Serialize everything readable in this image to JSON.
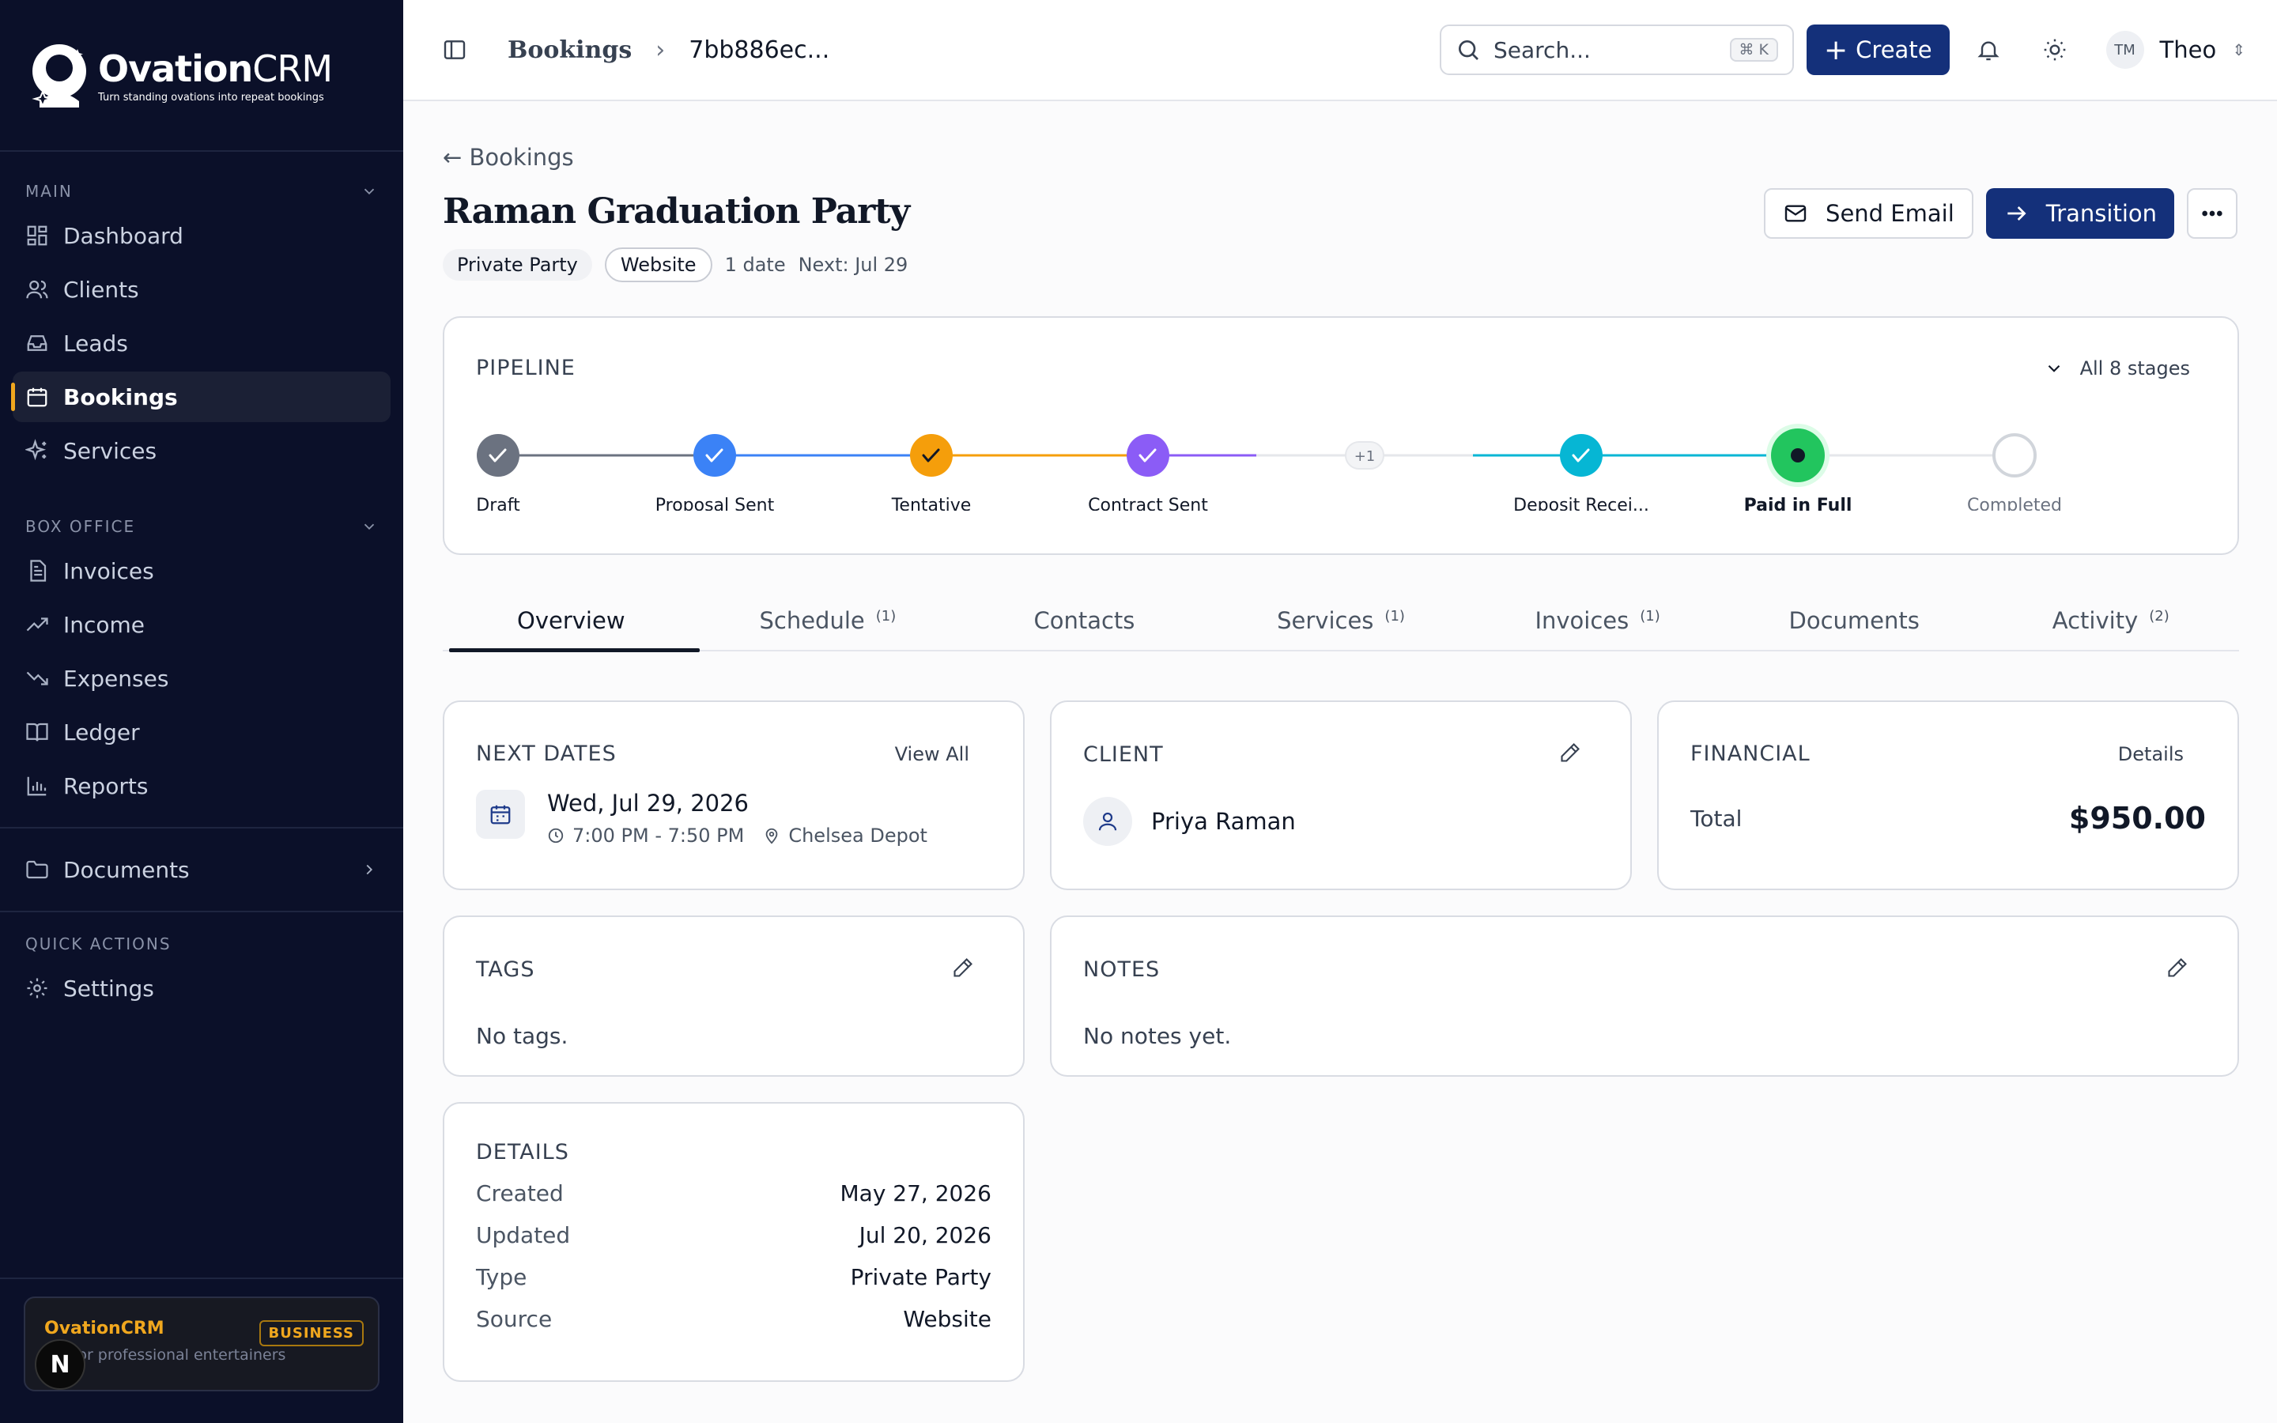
{
  "brand": {
    "name_bold": "Ovation",
    "name_light": "CRM",
    "tagline": "Turn standing ovations into repeat bookings"
  },
  "sidebar": {
    "sections": [
      {
        "title": "MAIN",
        "items": [
          {
            "label": "Dashboard",
            "icon": "dashboard-icon"
          },
          {
            "label": "Clients",
            "icon": "users-icon"
          },
          {
            "label": "Leads",
            "icon": "inbox-icon"
          },
          {
            "label": "Bookings",
            "icon": "calendar-icon",
            "active": true
          },
          {
            "label": "Services",
            "icon": "sparkles-icon"
          }
        ]
      },
      {
        "title": "BOX OFFICE",
        "items": [
          {
            "label": "Invoices",
            "icon": "file-icon"
          },
          {
            "label": "Income",
            "icon": "trend-up-icon"
          },
          {
            "label": "Expenses",
            "icon": "trend-down-icon"
          },
          {
            "label": "Ledger",
            "icon": "book-icon"
          },
          {
            "label": "Reports",
            "icon": "bar-chart-icon"
          }
        ]
      }
    ],
    "documents_label": "Documents",
    "quick_actions_title": "QUICK ACTIONS",
    "settings_label": "Settings",
    "plan": {
      "name": "OvationCRM",
      "desc": "RM for professional entertainers",
      "badge": "BUSINESS",
      "n_badge": "N"
    }
  },
  "topbar": {
    "breadcrumb_root": "Bookings",
    "breadcrumb_current": "7bb886ec...",
    "search_placeholder": "Search...",
    "search_shortcut": "⌘ K",
    "create_label": "Create",
    "user_initials": "TM",
    "user_name": "Theo"
  },
  "page": {
    "back_label": "← Bookings",
    "title": "Raman Graduation Party",
    "type_pill": "Private Party",
    "source_pill": "Website",
    "date_count": "1 date",
    "next_label": "Next: Jul 29",
    "send_email_label": "Send Email",
    "transition_label": "Transition"
  },
  "pipeline": {
    "title": "PIPELINE",
    "all_stages_label": "All 8 stages",
    "hidden_count": "+1",
    "stages": [
      {
        "label": "Draft",
        "status": "done",
        "color": "#6b7280"
      },
      {
        "label": "Proposal Sent",
        "status": "done",
        "color": "#3b82f6"
      },
      {
        "label": "Tentative",
        "status": "done",
        "color": "#f59e0b"
      },
      {
        "label": "Contract Sent",
        "status": "done",
        "color": "#8b5cf6"
      },
      {
        "label": "Deposit Recei...",
        "status": "done",
        "color": "#06b6d4"
      },
      {
        "label": "Paid in Full",
        "status": "current",
        "color": "#22c55e"
      },
      {
        "label": "Completed",
        "status": "pending",
        "color": "#d1d5db"
      }
    ]
  },
  "tabs": [
    {
      "label": "Overview",
      "count": "",
      "active": true
    },
    {
      "label": "Schedule",
      "count": "(1)"
    },
    {
      "label": "Contacts",
      "count": ""
    },
    {
      "label": "Services",
      "count": "(1)"
    },
    {
      "label": "Invoices",
      "count": "(1)"
    },
    {
      "label": "Documents",
      "count": ""
    },
    {
      "label": "Activity",
      "count": "(2)"
    }
  ],
  "next_dates": {
    "title": "NEXT DATES",
    "view_all": "View All",
    "date": "Wed, Jul 29, 2026",
    "time": "7:00 PM - 7:50 PM",
    "venue": "Chelsea Depot"
  },
  "client": {
    "title": "CLIENT",
    "name": "Priya Raman"
  },
  "financial": {
    "title": "FINANCIAL",
    "details_link": "Details",
    "total_label": "Total",
    "total_value": "$950.00"
  },
  "tags_card": {
    "title": "TAGS",
    "empty": "No tags."
  },
  "notes_card": {
    "title": "NOTES",
    "empty": "No notes yet."
  },
  "details_card": {
    "title": "DETAILS",
    "rows": [
      {
        "k": "Created",
        "v": "May 27, 2026"
      },
      {
        "k": "Updated",
        "v": "Jul 20, 2026"
      },
      {
        "k": "Type",
        "v": "Private Party"
      },
      {
        "k": "Source",
        "v": "Website"
      }
    ]
  }
}
